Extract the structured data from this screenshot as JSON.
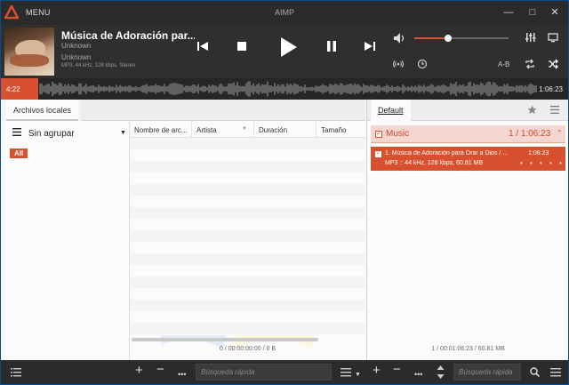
{
  "titlebar": {
    "menu_label": "MENU",
    "app_title": "AIMP",
    "minimize": "—",
    "maximize": "□",
    "close": "✕"
  },
  "player": {
    "title": "Música de Adoración par...",
    "artist": "Unknown",
    "album": "Unknown",
    "tech_info": "MP3, 44 kHz, 128 kbps, Stereo",
    "volume_fraction": 0.36,
    "ab_label": "A-B",
    "icons": [
      "prev-icon",
      "stop-icon",
      "play-icon",
      "pause-icon",
      "next-icon",
      "volume-icon",
      "equalizer-icon",
      "visualization-icon",
      "radio-icon",
      "timer-icon",
      "repeat-icon",
      "shuffle-icon"
    ]
  },
  "waveform": {
    "current_time": "4:22",
    "total_time": "1:06:23",
    "progress_fraction": 0.066
  },
  "library": {
    "tab_label": "Archivos locales",
    "grouping_label": "Sin agrupar",
    "all_badge": "All",
    "columns": [
      "Nombre de arc...",
      "Artista",
      "Duración",
      "Tamaño"
    ],
    "status": "0 / 00:00:00:00 / 0 B"
  },
  "playlist": {
    "tab_label": "Default",
    "group_name": "Music",
    "group_info": "1 / 1:06:23",
    "item_title": "1. Música de Adoración para Orar a Dios / ...",
    "item_duration": "1:06:23",
    "item_info": "MP3 :: 44 kHz, 128 kbps, 60.81 MB",
    "item_dots": "• • • • •",
    "status": "1 / 00:01:06:23 / 60.81 MB"
  },
  "bottombar": {
    "search_placeholder_left": "Búsqueda rápida",
    "search_placeholder_right": "Búsqueda rápida"
  },
  "colors": {
    "accent": "#d9502f",
    "dark_chrome": "#2b2b2b",
    "playlist_group_bg": "#f3d6cf"
  }
}
